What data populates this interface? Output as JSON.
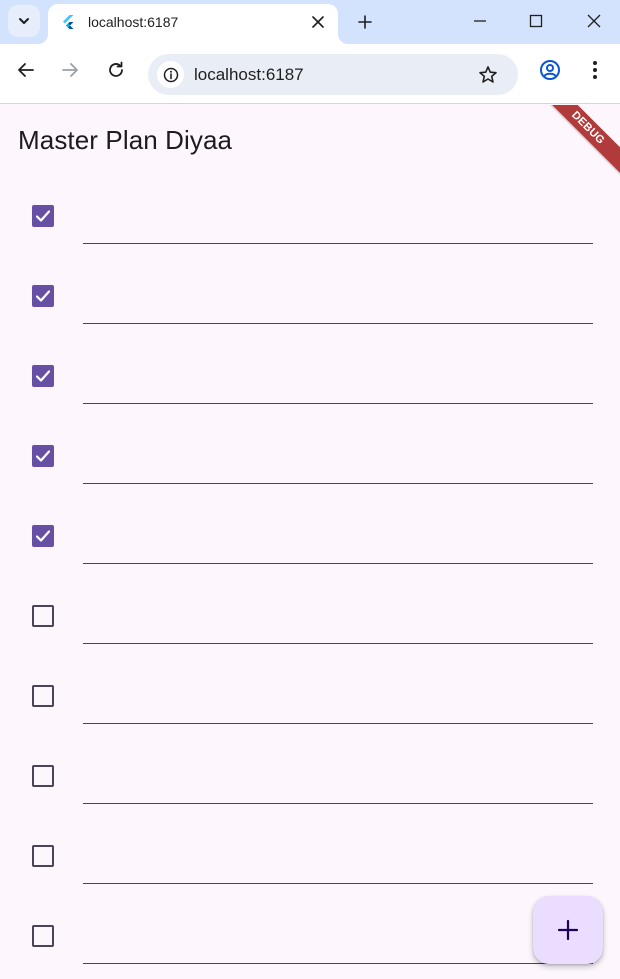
{
  "browser": {
    "tab_title": "localhost:6187",
    "url": "localhost:6187"
  },
  "app": {
    "title": "Master Plan Diyaa",
    "debug_label": "DEBUG",
    "accent_color": "#6750a4",
    "fab_color": "#eaddff",
    "tasks": [
      {
        "done": true,
        "text": ""
      },
      {
        "done": true,
        "text": ""
      },
      {
        "done": true,
        "text": ""
      },
      {
        "done": true,
        "text": ""
      },
      {
        "done": true,
        "text": ""
      },
      {
        "done": false,
        "text": ""
      },
      {
        "done": false,
        "text": ""
      },
      {
        "done": false,
        "text": ""
      },
      {
        "done": false,
        "text": ""
      },
      {
        "done": false,
        "text": ""
      }
    ],
    "fab_icon": "add-icon"
  }
}
